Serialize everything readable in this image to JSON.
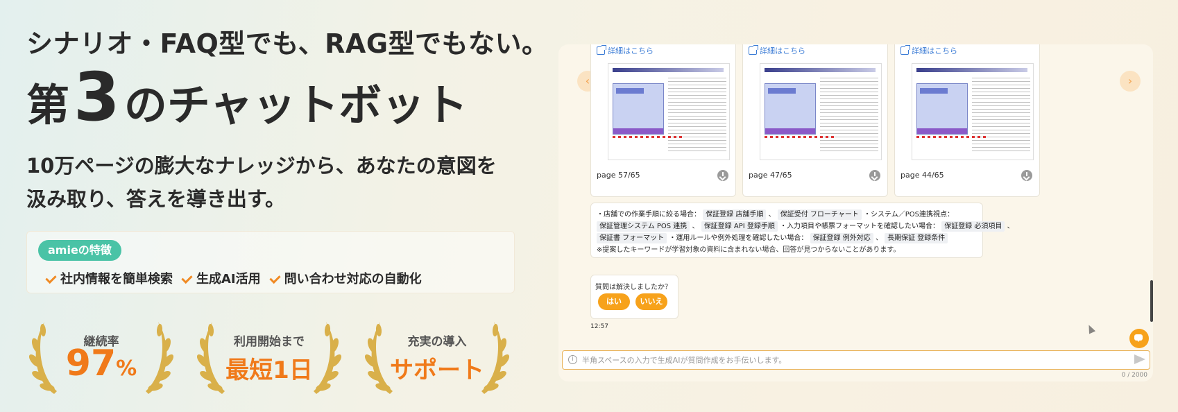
{
  "hero": {
    "headline_line1": "シナリオ・FAQ型でも、RAG型でもない。",
    "headline_part_a": "第",
    "headline_number": "3",
    "headline_part_b": "のチャットボット",
    "lead_line1": "10万ページの膨大なナレッジから、あなたの意図を",
    "lead_line2": "汲み取り、答えを導き出す。"
  },
  "features": {
    "badge": "amieの特徴",
    "items": [
      "社内情報を簡単検索",
      "生成AI活用",
      "問い合わせ対応の自動化"
    ]
  },
  "awards": [
    {
      "label": "継続率",
      "value": "97",
      "unit": "%"
    },
    {
      "label": "利用開始まで",
      "value": "最短1日"
    },
    {
      "label": "充実の導入",
      "value": "サポート"
    }
  ],
  "chat": {
    "nav_prev": "‹",
    "nav_next": "›",
    "doc_cards": [
      {
        "link": "詳細はこちら",
        "page": "page 57/65"
      },
      {
        "link": "詳細はこちら",
        "page": "page 47/65"
      },
      {
        "link": "詳細はこちら",
        "page": "page 44/65"
      }
    ],
    "answer": {
      "l1_a": "・店舗での作業手順に絞る場合：",
      "kw1": "保証登録 店舗手順",
      "l1_sep": "、",
      "kw2": "保証受付 フローチャート",
      "l1_b": "・システム／POS連携視点：",
      "kw3": "保証管理システム POS 連携",
      "l2_sep": "、",
      "kw4": "保証登録 API 登録手順",
      "l2_b": "・入力項目や帳票フォーマットを確認したい場合：",
      "kw5": "保証登録 必須項目",
      "l2_end": "、",
      "kw6": "保証書 フォーマット",
      "l3_b": "・運用ルールや例外処理を確認したい場合：",
      "kw7": "保証登録 例外対応",
      "l3_sep": "、",
      "kw8": "長期保証 登録条件",
      "note": "※提案したキーワードが学習対象の資料に含まれない場合、回答が見つからないことがあります。"
    },
    "feedback": {
      "question": "質問は解決しましたか？",
      "yes": "はい",
      "no": "いいえ"
    },
    "timestamp": "12:57",
    "input_placeholder": "半角スペースの入力で生成AIが質問作成をお手伝いします。",
    "info_icon": "i",
    "char_count": "0 / 2000"
  },
  "colors": {
    "accent_orange": "#f07a1a",
    "badge_green": "#4ac3a6",
    "button_orange": "#f7a21b",
    "link_blue": "#3a7bd5"
  }
}
